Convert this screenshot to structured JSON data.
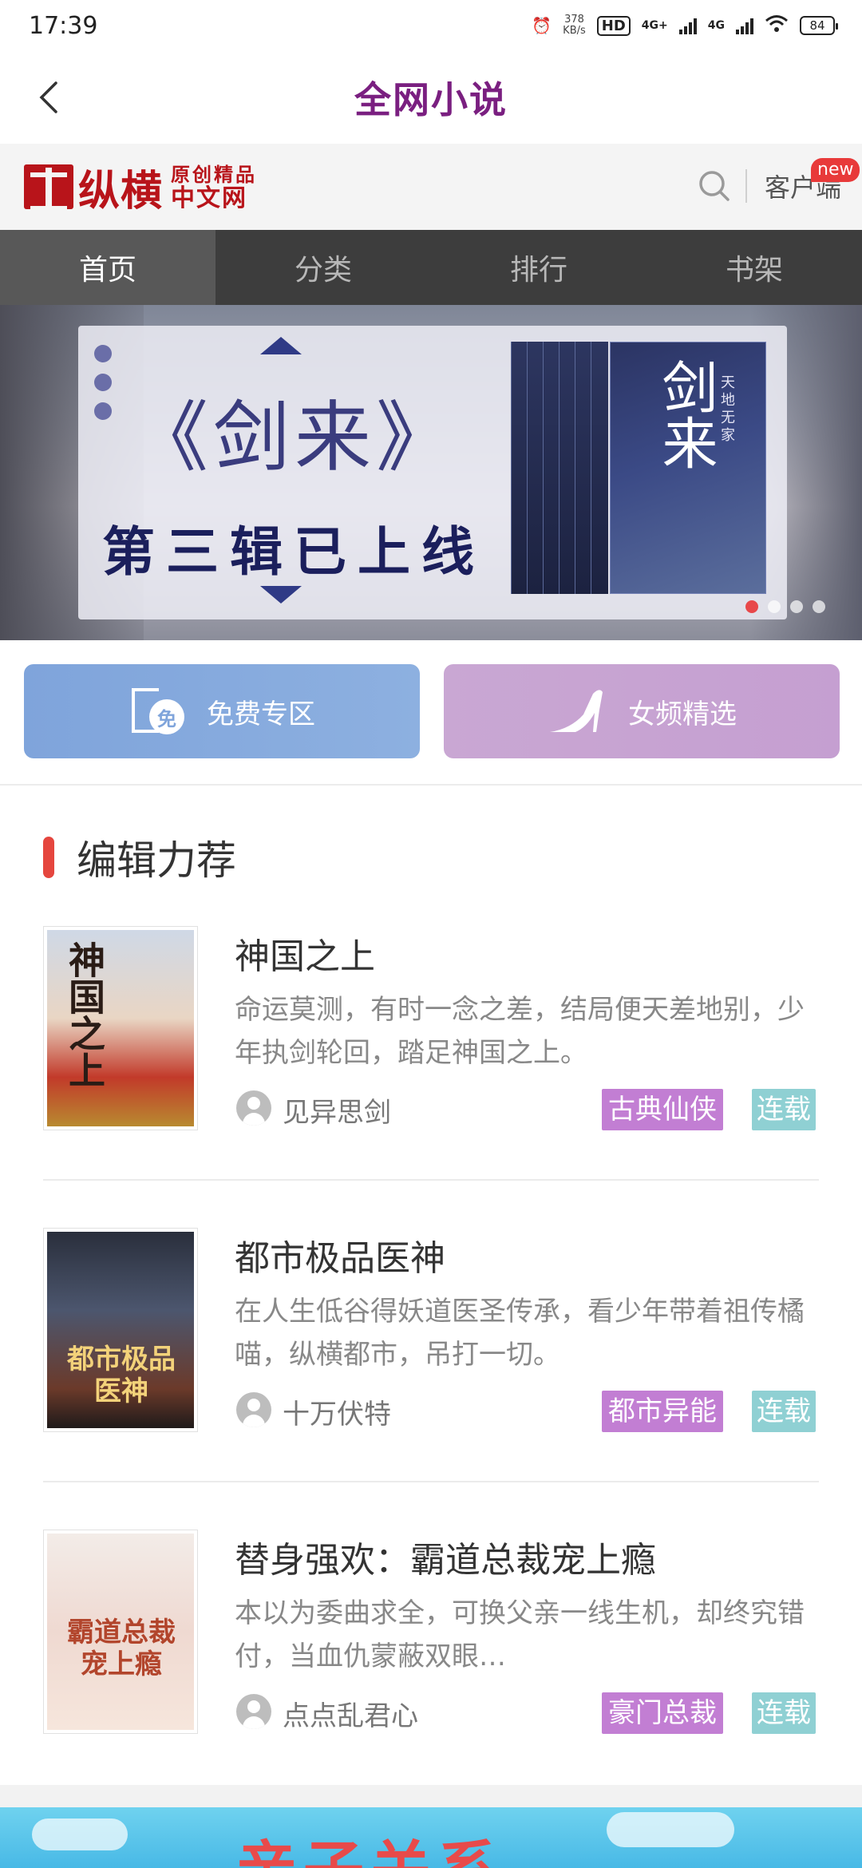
{
  "status_bar": {
    "time": "17:39",
    "net_speed": "378",
    "net_unit": "KB/s",
    "hd": "HD",
    "sim1": "4G+",
    "sim2": "4G",
    "battery": "84"
  },
  "header": {
    "title": "全网小说",
    "title_color": "#7a1f80"
  },
  "brand": {
    "logo_main": "纵横",
    "logo_sub_top": "原创精品",
    "logo_sub_bottom": "中文网",
    "client_label": "客户端",
    "new_badge": "new"
  },
  "nav": {
    "tabs": [
      "首页",
      "分类",
      "排行",
      "书架"
    ],
    "active": 0
  },
  "banner": {
    "title": "《剑来》",
    "subtitle": "第三辑已上线",
    "book_title": "剑来",
    "book_sub": "天地无家",
    "page_count": 4,
    "active_page": 0
  },
  "quick_entries": [
    {
      "label": "免费专区",
      "icon": "free-book-icon",
      "icon_text": "免"
    },
    {
      "label": "女频精选",
      "icon": "high-heel-icon"
    }
  ],
  "section": {
    "title": "编辑力荐",
    "accent": "#e5463e"
  },
  "books": [
    {
      "title": "神国之上",
      "description": "命运莫测，有时一念之差，结局便天差地别，少年执剑轮回，踏足神国之上。",
      "author": "见异思剑",
      "genre": "古典仙侠",
      "status": "连载",
      "cover_text": "神国之上"
    },
    {
      "title": "都市极品医神",
      "description": "在人生低谷得妖道医圣传承，看少年带着祖传橘喵，纵横都市，吊打一切。",
      "author": "十万伏特",
      "genre": "都市异能",
      "status": "连载",
      "cover_text": "都市极品医神"
    },
    {
      "title": "替身强欢：霸道总裁宠上瘾",
      "description": "本以为委曲求全，可换父亲一线生机，却终究错付，当血仇蒙蔽双眼…",
      "author": "点点乱君心",
      "genre": "豪门总裁",
      "status": "连载",
      "cover_text": "霸道总裁宠上瘾"
    }
  ],
  "bottom_banner": {
    "text": "亲子关系"
  }
}
